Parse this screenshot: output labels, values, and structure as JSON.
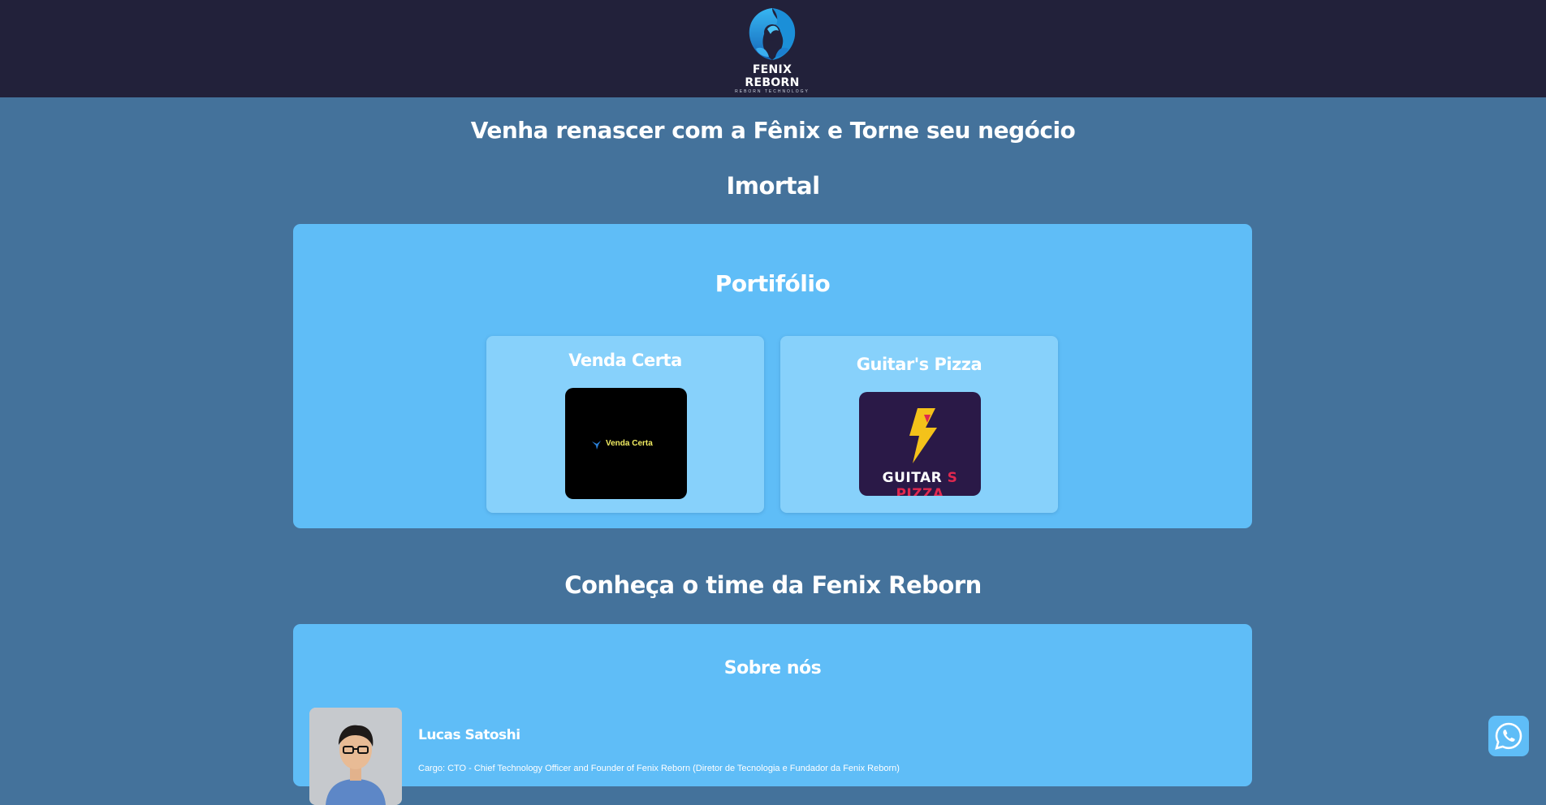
{
  "header": {
    "logo_text": "FENIX REBORN",
    "logo_subtext": "REBORN TECHNOLOGY",
    "logo_icon": "phoenix-icon"
  },
  "hero": {
    "line1": "Venha renascer com a Fênix e Torne seu negócio",
    "line2": "Imortal"
  },
  "portfolio": {
    "title": "Portifólio",
    "items": [
      {
        "title": "Venda Certa",
        "image_text": "Venda Certa"
      },
      {
        "title": "Guitar's Pizza",
        "image_text_1": "GUITAR",
        "image_text_2": "S",
        "image_text_3": "PIZZA"
      }
    ]
  },
  "team": {
    "heading": "Conheça o time da Fenix Reborn",
    "section_title": "Sobre nós",
    "members": [
      {
        "name": "Lucas Satoshi",
        "role": "Cargo: CTO - Chief Technology Officer and Founder of Fenix Reborn (Diretor de Tecnologia e Fundador da Fenix Reborn)"
      }
    ]
  },
  "floating": {
    "whatsapp_icon": "whatsapp-icon"
  },
  "colors": {
    "page_background": "#44729b",
    "header_background": "#22213a",
    "panel_background": "#5fbdf7",
    "card_background": "#87d1fb",
    "logo_blue": "#1e9be0"
  }
}
